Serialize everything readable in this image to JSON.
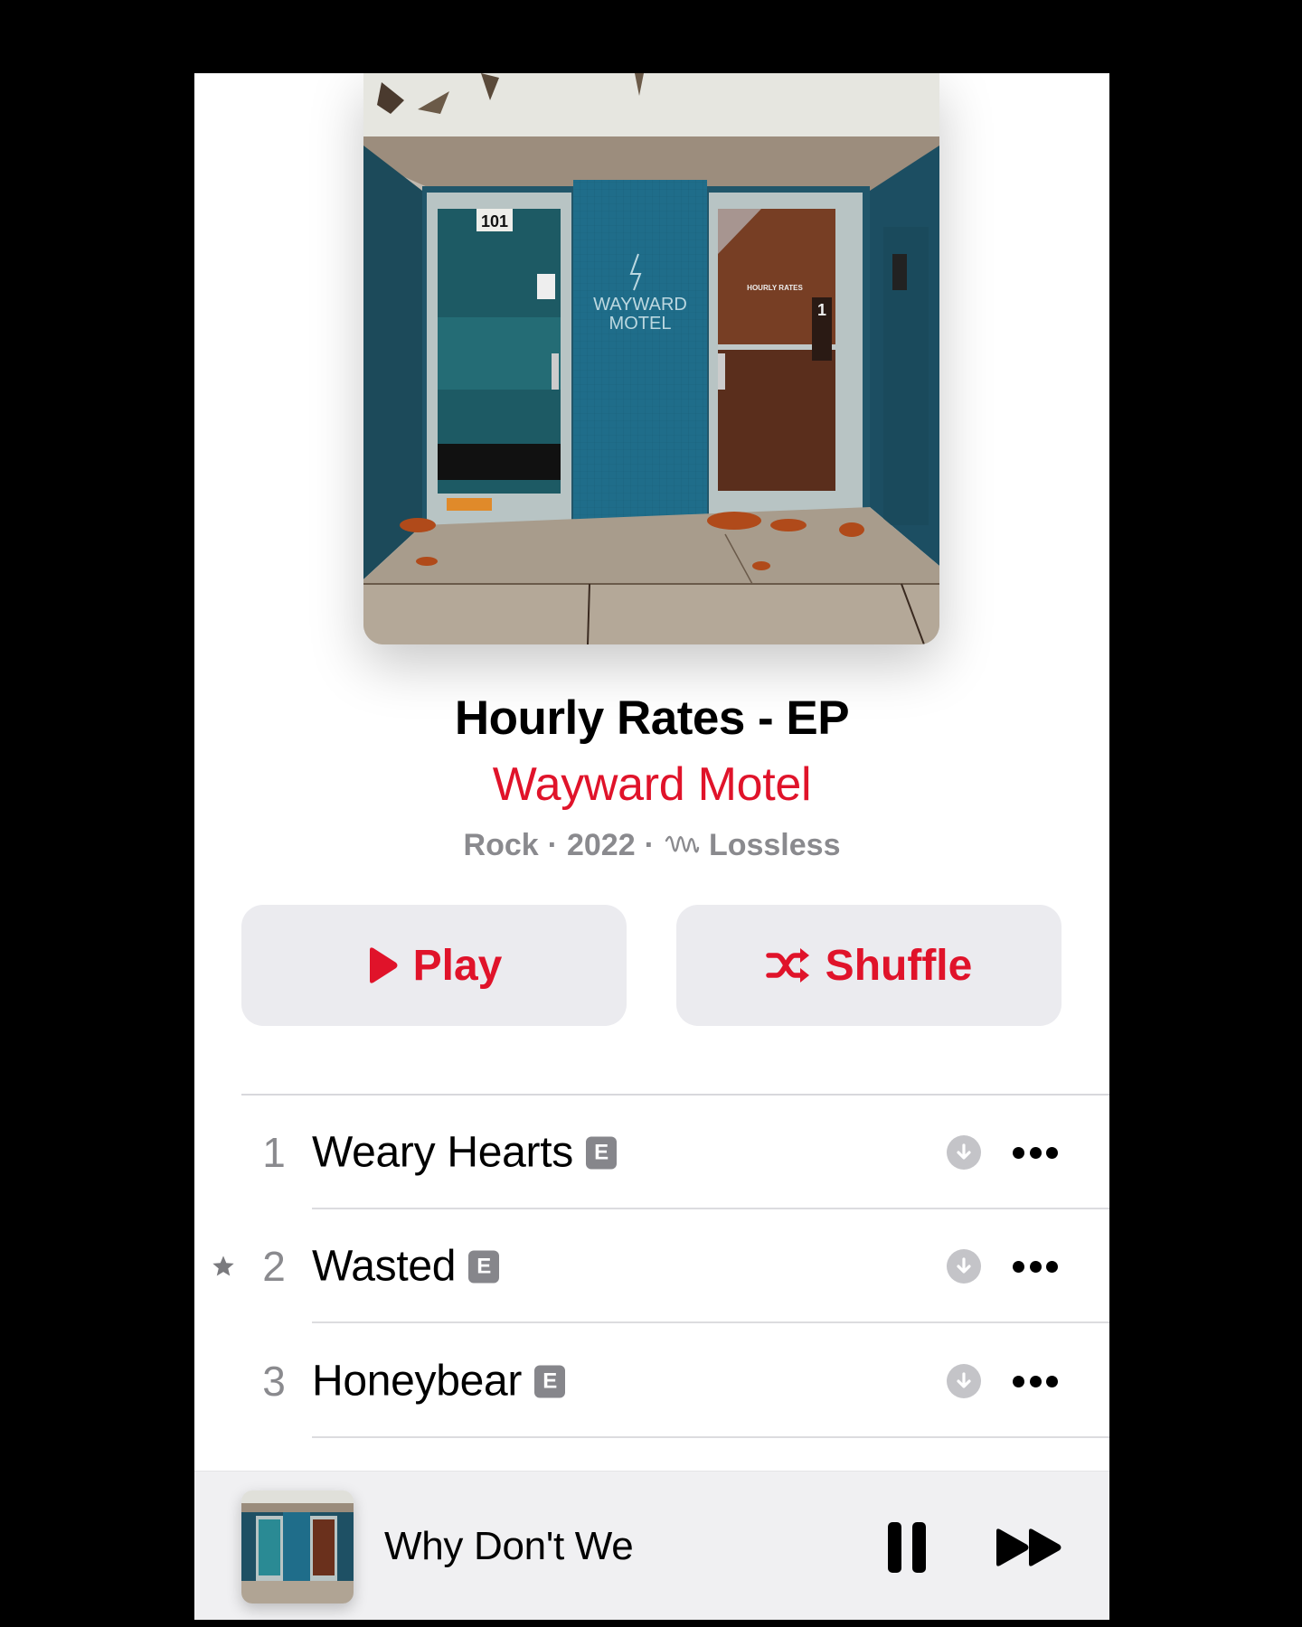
{
  "album": {
    "title": "Hourly Rates - EP",
    "artist": "Wayward Motel",
    "genre": "Rock",
    "year": "2022",
    "quality": "Lossless",
    "separator": "·",
    "cover_text": {
      "door_number": "101",
      "logo_line1": "WAYWARD",
      "logo_line2": "MOTEL",
      "window_text": "HOURLY RATES",
      "window_number": "1"
    }
  },
  "actions": {
    "play_label": "Play",
    "shuffle_label": "Shuffle"
  },
  "tracks": [
    {
      "number": "1",
      "title": "Weary Hearts",
      "explicit_label": "E",
      "starred": false
    },
    {
      "number": "2",
      "title": "Wasted",
      "explicit_label": "E",
      "starred": true
    },
    {
      "number": "3",
      "title": "Honeybear",
      "explicit_label": "E",
      "starred": false
    }
  ],
  "now_playing": {
    "title": "Why Don't We",
    "state": "playing"
  },
  "colors": {
    "accent": "#e0132a",
    "secondary_text": "#8a8a8e",
    "button_bg": "#ebebef"
  }
}
